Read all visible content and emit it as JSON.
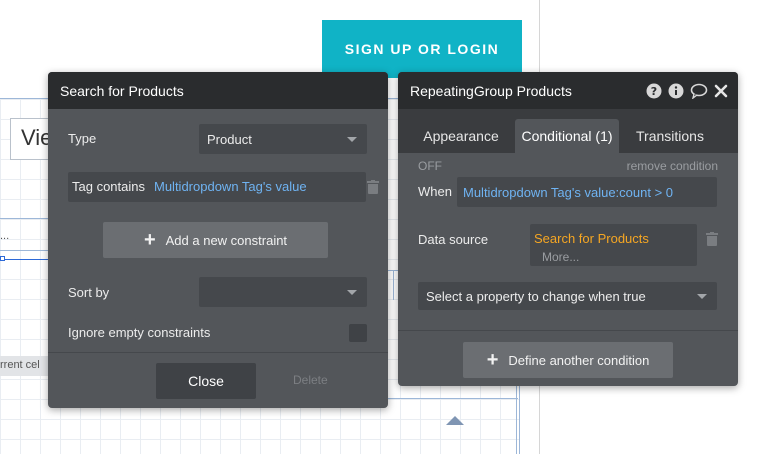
{
  "background": {
    "signup_label": "SIGN UP OR LOGIN",
    "input_partial": "Vie",
    "dots": "...",
    "cell_chip": "rrent cel"
  },
  "search_panel": {
    "title": "Search for Products",
    "type_label": "Type",
    "type_value": "Product",
    "constraint_label": "Tag contains",
    "constraint_value": "Multidropdown Tag's value",
    "add_constraint_label": "Add a new constraint",
    "sort_label": "Sort by",
    "sort_value": "",
    "ignore_label": "Ignore empty constraints",
    "close_label": "Close",
    "delete_label": "Delete"
  },
  "rg_panel": {
    "title": "RepeatingGroup Products",
    "icons": [
      "help-icon",
      "info-icon",
      "comment-icon",
      "close-icon"
    ],
    "tabs": [
      {
        "label": "Appearance"
      },
      {
        "label": "Conditional (1)",
        "active": true
      },
      {
        "label": "Transitions"
      }
    ],
    "off_label": "OFF",
    "remove_label": "remove condition",
    "when_label": "When",
    "when_value": "Multidropdown Tag's value:count > 0",
    "data_source_label": "Data source",
    "data_source_value": "Search for Products",
    "more_label": "More...",
    "property_placeholder": "Select a property to change when true",
    "define_label": "Define another condition"
  },
  "colors": {
    "signup": "#10b3c6",
    "panel_bg": "#53565a",
    "header_bg": "#2a2c2e",
    "expression_blue": "#6fb3f2",
    "expression_orange": "#f5a623"
  }
}
